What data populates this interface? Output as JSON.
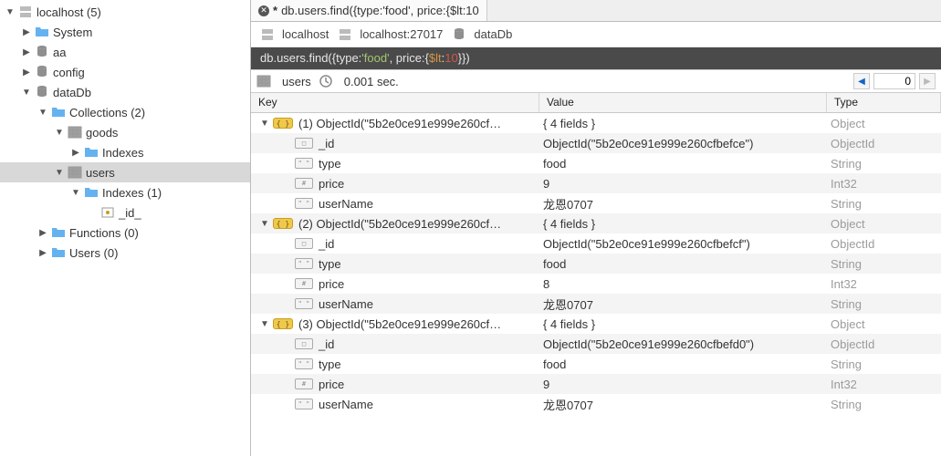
{
  "sidebar": {
    "root": "localhost (5)",
    "items": [
      {
        "label": "System",
        "icon": "folder",
        "indent": 1,
        "tw": "▶"
      },
      {
        "label": "aa",
        "icon": "db",
        "indent": 1,
        "tw": "▶"
      },
      {
        "label": "config",
        "icon": "db",
        "indent": 1,
        "tw": "▶"
      },
      {
        "label": "dataDb",
        "icon": "db",
        "indent": 1,
        "tw": "▼"
      },
      {
        "label": "Collections (2)",
        "icon": "folder",
        "indent": 2,
        "tw": "▼"
      },
      {
        "label": "goods",
        "icon": "grid",
        "indent": 3,
        "tw": "▼"
      },
      {
        "label": "Indexes",
        "icon": "folder",
        "indent": 4,
        "tw": "▶"
      },
      {
        "label": "users",
        "icon": "grid",
        "indent": 3,
        "tw": "▼",
        "selected": true
      },
      {
        "label": "Indexes (1)",
        "icon": "folder",
        "indent": 4,
        "tw": "▼"
      },
      {
        "label": "_id_",
        "icon": "key",
        "indent": 5,
        "tw": ""
      },
      {
        "label": "Functions (0)",
        "icon": "folder",
        "indent": 2,
        "tw": "▶"
      },
      {
        "label": "Users (0)",
        "icon": "folder",
        "indent": 2,
        "tw": "▶"
      }
    ]
  },
  "tab": {
    "dirty": "*",
    "title": "db.users.find({type:'food', price:{$lt:10"
  },
  "breadcrumb": {
    "host": "localhost",
    "conn": "localhost:27017",
    "db": "dataDb"
  },
  "query": {
    "p1": "db.users.find({type:",
    "p2": "'food'",
    "p3": ", price:{",
    "p4": "$lt",
    "p5": ":",
    "p6": "10",
    "p7": "}})"
  },
  "status": {
    "collection": "users",
    "time": "0.001 sec.",
    "page": "0"
  },
  "columns": {
    "key": "Key",
    "value": "Value",
    "type": "Type"
  },
  "rows": [
    {
      "k": "(1) ObjectId(\"5b2e0ce91e999e260cf…",
      "v": "{ 4 fields }",
      "t": "Object",
      "kind": "obj",
      "indent": 0,
      "tw": "▼"
    },
    {
      "k": "_id",
      "v": "ObjectId(\"5b2e0ce91e999e260cfbefce\")",
      "t": "ObjectId",
      "kind": "oid",
      "indent": 1
    },
    {
      "k": "type",
      "v": "food",
      "t": "String",
      "kind": "str",
      "indent": 1
    },
    {
      "k": "price",
      "v": "9",
      "t": "Int32",
      "kind": "int",
      "indent": 1
    },
    {
      "k": "userName",
      "v": "龙恩0707",
      "t": "String",
      "kind": "str",
      "indent": 1
    },
    {
      "k": "(2) ObjectId(\"5b2e0ce91e999e260cf…",
      "v": "{ 4 fields }",
      "t": "Object",
      "kind": "obj",
      "indent": 0,
      "tw": "▼"
    },
    {
      "k": "_id",
      "v": "ObjectId(\"5b2e0ce91e999e260cfbefcf\")",
      "t": "ObjectId",
      "kind": "oid",
      "indent": 1
    },
    {
      "k": "type",
      "v": "food",
      "t": "String",
      "kind": "str",
      "indent": 1
    },
    {
      "k": "price",
      "v": "8",
      "t": "Int32",
      "kind": "int",
      "indent": 1
    },
    {
      "k": "userName",
      "v": "龙恩0707",
      "t": "String",
      "kind": "str",
      "indent": 1
    },
    {
      "k": "(3) ObjectId(\"5b2e0ce91e999e260cf…",
      "v": "{ 4 fields }",
      "t": "Object",
      "kind": "obj",
      "indent": 0,
      "tw": "▼"
    },
    {
      "k": "_id",
      "v": "ObjectId(\"5b2e0ce91e999e260cfbefd0\")",
      "t": "ObjectId",
      "kind": "oid",
      "indent": 1
    },
    {
      "k": "type",
      "v": "food",
      "t": "String",
      "kind": "str",
      "indent": 1
    },
    {
      "k": "price",
      "v": "9",
      "t": "Int32",
      "kind": "int",
      "indent": 1
    },
    {
      "k": "userName",
      "v": "龙恩0707",
      "t": "String",
      "kind": "str",
      "indent": 1
    }
  ]
}
